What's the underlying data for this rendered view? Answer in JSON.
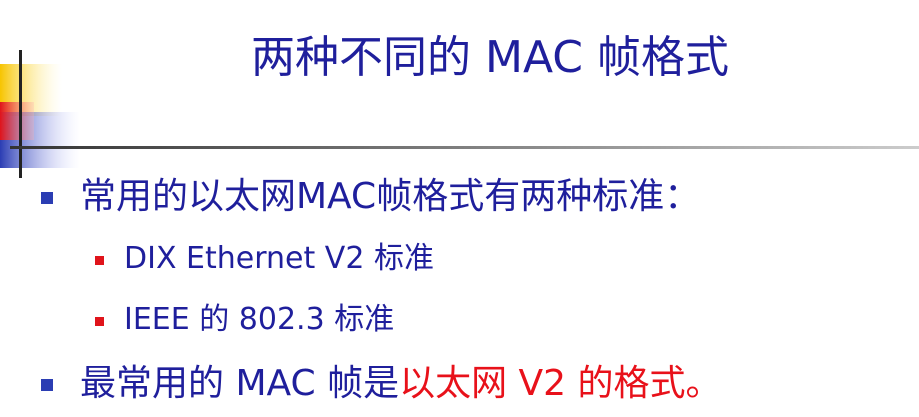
{
  "slide": {
    "title": "两种不同的 MAC 帧格式",
    "bullets": [
      {
        "text": "常用的以太网MAC帧格式有两种标准：",
        "sub": [
          {
            "text": "DIX Ethernet V2 标准"
          },
          {
            "text": "IEEE 的 802.3 标准"
          }
        ]
      },
      {
        "text_plain": "最常用的 MAC 帧是",
        "text_accent": "以太网 V2 的格式。"
      }
    ]
  },
  "colors": {
    "title": "#1f1f9c",
    "text": "#1f1f9c",
    "accent": "#e8111a",
    "bullet_level1": "#2b3db3",
    "bullet_level2": "#e0141b",
    "decor_yellow": "#f7c400",
    "decor_red": "#e0141b",
    "decor_blue": "#2b3db3"
  }
}
